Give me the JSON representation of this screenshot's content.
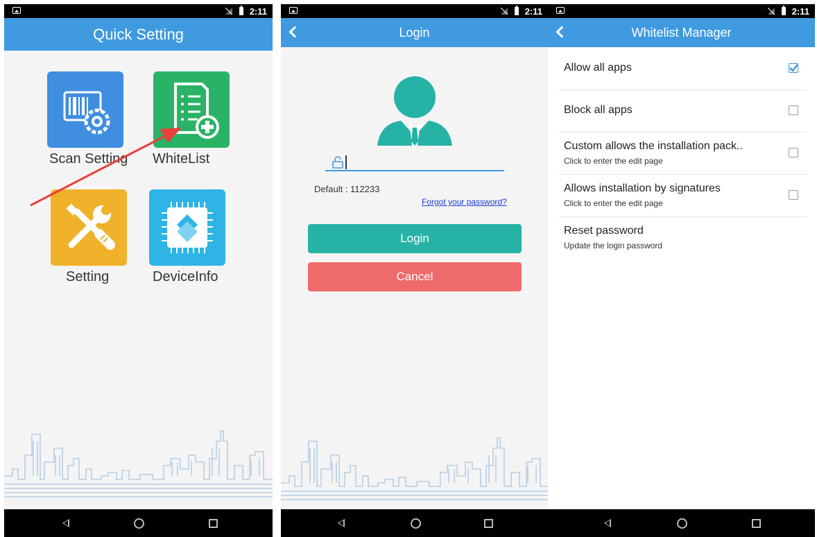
{
  "status_bar": {
    "time": "2:11"
  },
  "screen_quick": {
    "title": "Quick Setting",
    "tiles": [
      {
        "label": "Scan Setting",
        "icon": "barcode-gear-icon",
        "color": "#3f8ee0"
      },
      {
        "label": "WhiteList",
        "icon": "whitelist-add-icon",
        "color": "#2ab366"
      },
      {
        "label": "Setting",
        "icon": "wrench-screwdriver-icon",
        "color": "#f0b22a"
      },
      {
        "label": "DeviceInfo",
        "icon": "chip-icon",
        "color": "#2fb4e6"
      }
    ],
    "arrow_color": "#e8403a"
  },
  "screen_login": {
    "title": "Login",
    "password_value": "",
    "default_hint": "Default : 112233",
    "forgot_link": "Forgot your password?",
    "login_button": "Login",
    "cancel_button": "Cancel",
    "colors": {
      "accent": "#27b2a6",
      "cancel": "#ef6a6a",
      "appbar": "#3f9ae0"
    }
  },
  "screen_whitelist": {
    "title": "Whitelist Manager",
    "items": [
      {
        "title": "Allow all apps",
        "subtitle": "",
        "checked": true
      },
      {
        "title": "Block all apps",
        "subtitle": "",
        "checked": false
      },
      {
        "title": "Custom allows the installation pack..",
        "subtitle": "Click to enter the edit page",
        "checked": false
      },
      {
        "title": "Allows installation by signatures",
        "subtitle": "Click to enter the edit page",
        "checked": false
      },
      {
        "title": "Reset password",
        "subtitle": "Update the login password",
        "checked": null
      }
    ]
  }
}
